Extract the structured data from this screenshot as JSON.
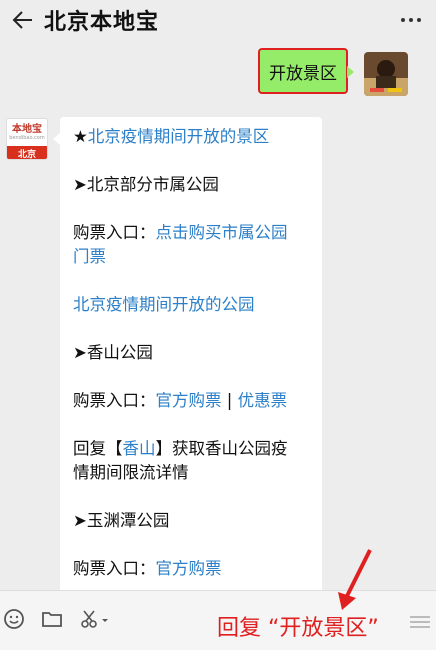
{
  "header": {
    "back_icon": "back-arrow-icon",
    "title": "北京本地宝",
    "more_icon": "more-dots-icon"
  },
  "outgoing": {
    "text": "开放景区"
  },
  "bot_avatar": {
    "logo_text": "本地宝",
    "url_text": "bendibao.com",
    "city_text": "北京"
  },
  "message": {
    "p1": {
      "star": "★",
      "link": "北京疫情期间开放的景区"
    },
    "p2": "➤北京部分市属公园",
    "p3": {
      "prefix": "购票入口：",
      "link_line1": "点击购买市属公园",
      "link_line2": "门票"
    },
    "p4": {
      "link": "北京疫情期间开放的公园"
    },
    "p5": "➤香山公园",
    "p6": {
      "prefix": "购票入口：",
      "link1": "官方购票",
      "sep": " | ",
      "link2": "优惠票"
    },
    "p7": {
      "pre": "回复【",
      "link": "香山",
      "post": "】获取香山公园疫",
      "line2": "情期间限流详情"
    },
    "p8": "➤玉渊潭公园",
    "p9": {
      "prefix": "购票入口：",
      "link": "官方购票"
    }
  },
  "bottom_bar": {
    "icons": [
      "emoji-icon",
      "folder-icon",
      "scissors-icon",
      "menu-icon"
    ],
    "caption": "回复 “开放景区”"
  },
  "colors": {
    "link": "#2c7fc8",
    "outgoing_bubble": "#95ec69",
    "highlight": "#e02020"
  }
}
